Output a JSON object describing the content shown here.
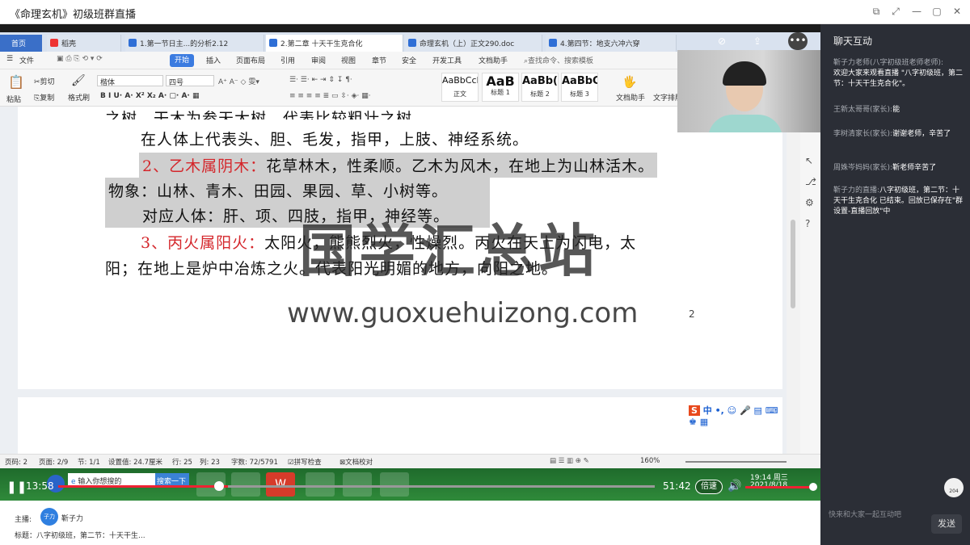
{
  "window": {
    "title": "《命理玄机》初级班群直播"
  },
  "wps": {
    "tabs": [
      {
        "label": "首页"
      },
      {
        "label": "稻壳"
      },
      {
        "label": "1.第一节日主...的分析2.12"
      },
      {
        "label": "2.第二章 十天干生克合化"
      },
      {
        "label": "命理玄机（上）正文290.doc"
      },
      {
        "label": "4.第四节：地支六冲六穿"
      }
    ],
    "menu": [
      "文件",
      "开始",
      "插入",
      "页面布局",
      "引用",
      "审阅",
      "视图",
      "章节",
      "安全",
      "开发工具",
      "文档助手"
    ],
    "search_placeholder": "查找命令、搜索模板",
    "ribbon": {
      "paste": "粘贴",
      "cut": "剪切",
      "copy": "复制",
      "format_painter": "格式刷",
      "font": "楷体",
      "size": "四号",
      "styles": [
        {
          "preview": "AaBbCcDd",
          "name": "正文"
        },
        {
          "preview": "AaB",
          "name": "标题 1"
        },
        {
          "preview": "AaBb(",
          "name": "标题 2"
        },
        {
          "preview": "AaBbC",
          "name": "标题 3"
        }
      ],
      "doc_assistant": "文档助手",
      "text_layout": "文字排版"
    },
    "doc": {
      "line0": "之树，干木为参天大树，代表比较粗壮之树。",
      "line1": "在人体上代表头、胆、毛发，指甲，上肢、神经系统。",
      "line2_red": "2、乙木属阴木：",
      "line2": "花草林木，性柔顺。乙木为风木，在地上为山林活木。",
      "line3": "物象：山林、青木、田园、果园、草、小树等。",
      "line4": "对应人体：肝、项、四肢，指甲，神经等。",
      "line5_red": "3、丙火属阳火：",
      "line5": "太阳火，熊熊烈火，性燥烈。丙火在天上为闪电，太",
      "line6": "阳；在地上是炉中冶炼之火。代表阳光明媚的地方，向阳之地。",
      "page_num": "2"
    },
    "status": {
      "page": "页码: 2",
      "pages": "页面: 2/9",
      "section": "节: 1/1",
      "setting": "设置值: 24.7厘米",
      "row": "行: 25",
      "col": "列: 23",
      "words": "字数: 72/5791",
      "spell": "拼写检查",
      "proof": "文档校对",
      "zoom": "160%"
    },
    "ime": "中"
  },
  "taskbar": {
    "search_text": "输入你想搜的",
    "search_btn": "搜索一下",
    "time": "19:14 周三",
    "date": "2021/8/18"
  },
  "player": {
    "current": "13:58",
    "total": "51:42",
    "speed": "倍速",
    "progress": 0.27,
    "viewers": "204"
  },
  "watermark": {
    "cn": "国学汇总站",
    "url": "www.guoxuehuizong.com"
  },
  "host": {
    "label": "主播:",
    "avatar": "子力",
    "name": "靳子力",
    "topic": "标题：八字初级班，第二节：十天干生..."
  },
  "chat": {
    "title": "聊天互动",
    "messages": [
      {
        "name": "靳子力老师(八字初级班老师老师):",
        "text": "欢迎大家来观看直播 \"八字初级班，第二节：十天干生克合化\"。"
      },
      {
        "name": "王新太哥哥(家长):",
        "text": "能"
      },
      {
        "name": "李树清家长(家长):",
        "text": "谢谢老师，辛苦了"
      },
      {
        "name": "周姝岑妈妈(家长):",
        "text": "靳老师辛苦了"
      },
      {
        "name": "靳子力的直播:",
        "text": "八字初级班，第二节：十天干生克合化 已结束。回放已保存在\"群设置-直播回放\"中"
      }
    ],
    "input_placeholder": "快来和大家一起互动吧",
    "send": "发送"
  }
}
